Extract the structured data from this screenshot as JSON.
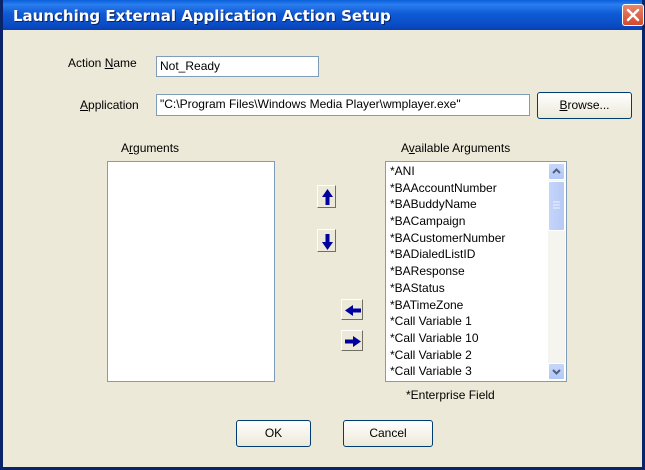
{
  "window": {
    "title": "Launching External Application Action Setup"
  },
  "form": {
    "action_name_label_pre": "Action ",
    "action_name_label_ul": "N",
    "action_name_label_post": "ame",
    "action_name_value": "Not_Ready",
    "application_label_pre": "",
    "application_label_ul": "A",
    "application_label_post": "pplication",
    "application_value": "\"C:\\Program Files\\Windows Media Player\\wmplayer.exe\"",
    "browse_pre": "",
    "browse_ul": "B",
    "browse_post": "rowse..."
  },
  "arguments": {
    "label_pre": "A",
    "label_ul": "r",
    "label_post": "guments",
    "items": []
  },
  "available": {
    "label_pre": "A",
    "label_ul": "v",
    "label_post": "ailable Arguments",
    "items": [
      "*ANI",
      "*BAAccountNumber",
      "*BABuddyName",
      "*BACampaign",
      "*BACustomerNumber",
      "*BADialedListID",
      "*BAResponse",
      "*BAStatus",
      "*BATimeZone",
      "*Call Variable 1",
      "*Call Variable 10",
      "*Call Variable 2",
      "*Call Variable 3"
    ],
    "footnote": "*Enterprise Field"
  },
  "buttons": {
    "ok": "OK",
    "cancel": "Cancel"
  },
  "icons": {
    "move_up": "arrow-up-icon",
    "move_down": "arrow-down-icon",
    "move_left": "arrow-left-icon",
    "move_right": "arrow-right-icon",
    "close": "close-icon"
  },
  "colors": {
    "titlebar": "#0a4bc4",
    "arrow_fill": "#0000a0",
    "close_red": "#d2492c"
  }
}
